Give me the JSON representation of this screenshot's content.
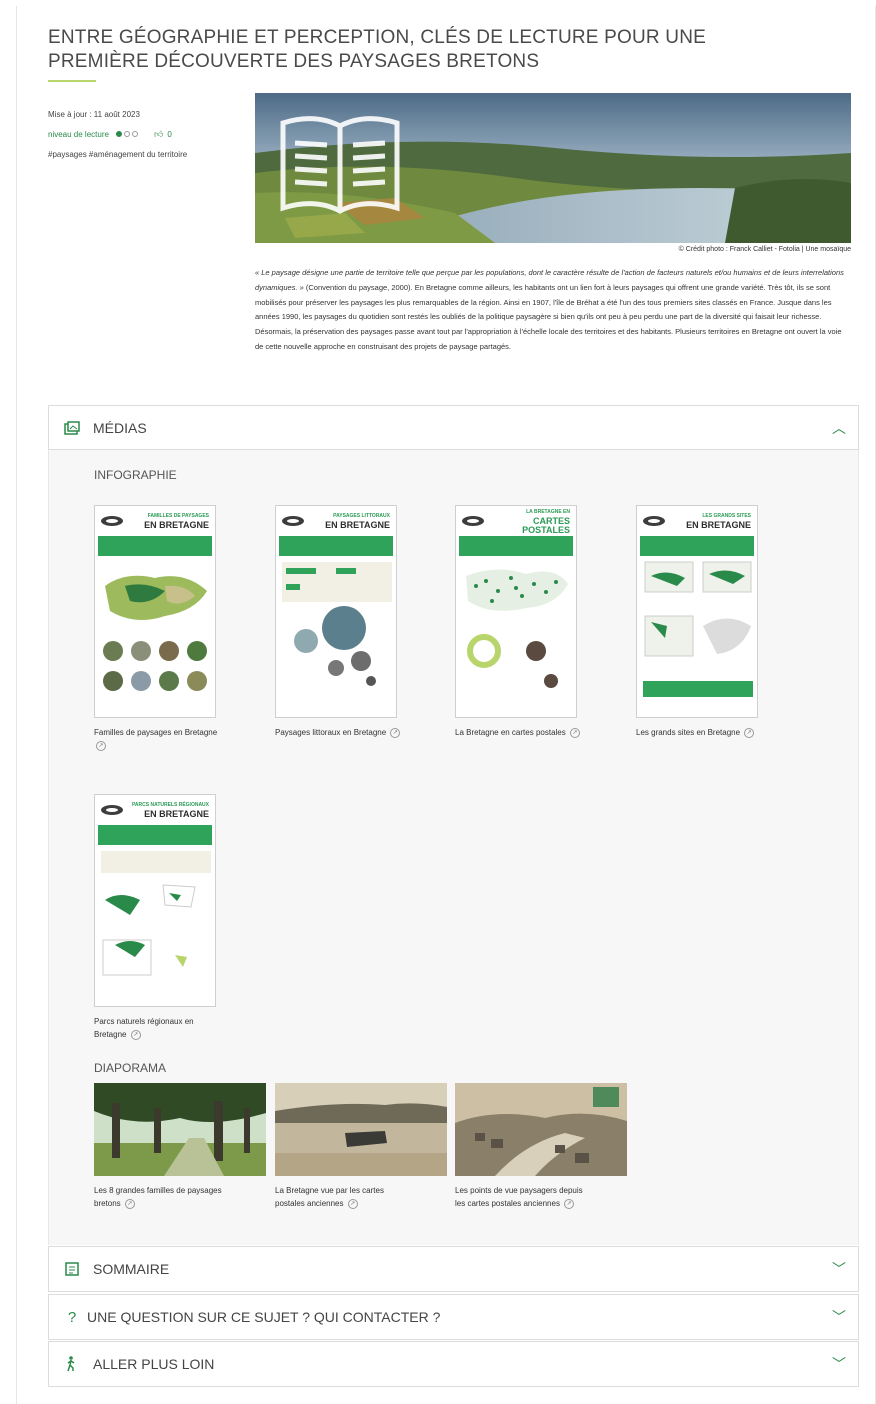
{
  "article": {
    "title": "ENTRE GÉOGRAPHIE ET PERCEPTION, CLÉS DE LECTURE POUR UNE PREMIÈRE DÉCOUVERTE DES PAYSAGES BRETONS",
    "updated": "Mise à jour : 11 août 2023",
    "reading_level_label": "niveau de lecture",
    "reading_level": 1,
    "reading_level_max": 3,
    "likes": "0",
    "tags": "#paysages #aménagement du territoire",
    "photo_credit": "© Crédit photo : Franck Calliet - Fotolia | Une mosaïque",
    "intro_quote": "« Le paysage désigne une partie de territoire telle que perçue par les populations, dont le caractère résulte de l'action de facteurs naturels et/ou humains et de leurs interrelations dynamiques. »",
    "intro_text": " (Convention du paysage, 2000). En Bretagne comme ailleurs, les habitants ont un lien fort à leurs paysages qui offrent une grande variété. Très tôt, ils se sont mobilisés pour préserver les paysages les plus remarquables de la région. Ainsi en 1907, l'île de Bréhat a été l'un des tous premiers sites classés en France. Jusque dans les années 1990, les paysages du quotidien sont restés les oubliés de la politique paysagère si bien qu'ils ont peu à peu perdu une part de la diversité qui faisait leur richesse. Désormais, la préservation des paysages passe avant tout par l'appropriation à l'échelle locale des territoires et des habitants. Plusieurs territoires en Bretagne ont ouvert la voie de cette nouvelle approche en construisant des projets de paysage partagés."
  },
  "medias": {
    "label": "MÉDIAS",
    "infographie_label": "INFOGRAPHIE",
    "infographics": [
      {
        "poster_sub": "FAMILLES DE PAYSAGES",
        "poster_title": "EN BRETAGNE",
        "caption": "Familles de paysages en Bretagne"
      },
      {
        "poster_sub": "PAYSAGES LITTORAUX",
        "poster_title": "EN BRETAGNE",
        "caption": "Paysages littoraux en Bretagne"
      },
      {
        "poster_sub": "LA BRETAGNE EN",
        "poster_title": "CARTES POSTALES",
        "caption": "La Bretagne en cartes postales"
      },
      {
        "poster_sub": "LES GRANDS SITES",
        "poster_title": "EN BRETAGNE",
        "caption": "Les grands sites en Bretagne"
      },
      {
        "poster_sub": "PARCS NATURELS RÉGIONAUX",
        "poster_title": "EN BRETAGNE",
        "caption": "Parcs naturels régionaux en Bretagne"
      }
    ],
    "diaporama_label": "DIAPORAMA",
    "slideshows": [
      {
        "caption": "Les 8 grandes familles de paysages bretons"
      },
      {
        "caption": "La Bretagne vue par les cartes postales anciennes"
      },
      {
        "caption": "Les points de vue paysagers depuis les cartes postales anciennes"
      }
    ]
  },
  "sections": {
    "sommaire": "SOMMAIRE",
    "question": "UNE QUESTION SUR CE SUJET ? QUI CONTACTER ?",
    "aller_plus_loin": "ALLER PLUS LOIN"
  },
  "colors": {
    "accent": "#2a8a4a",
    "underline": "#b8d56c",
    "band": "#2fa35a"
  }
}
